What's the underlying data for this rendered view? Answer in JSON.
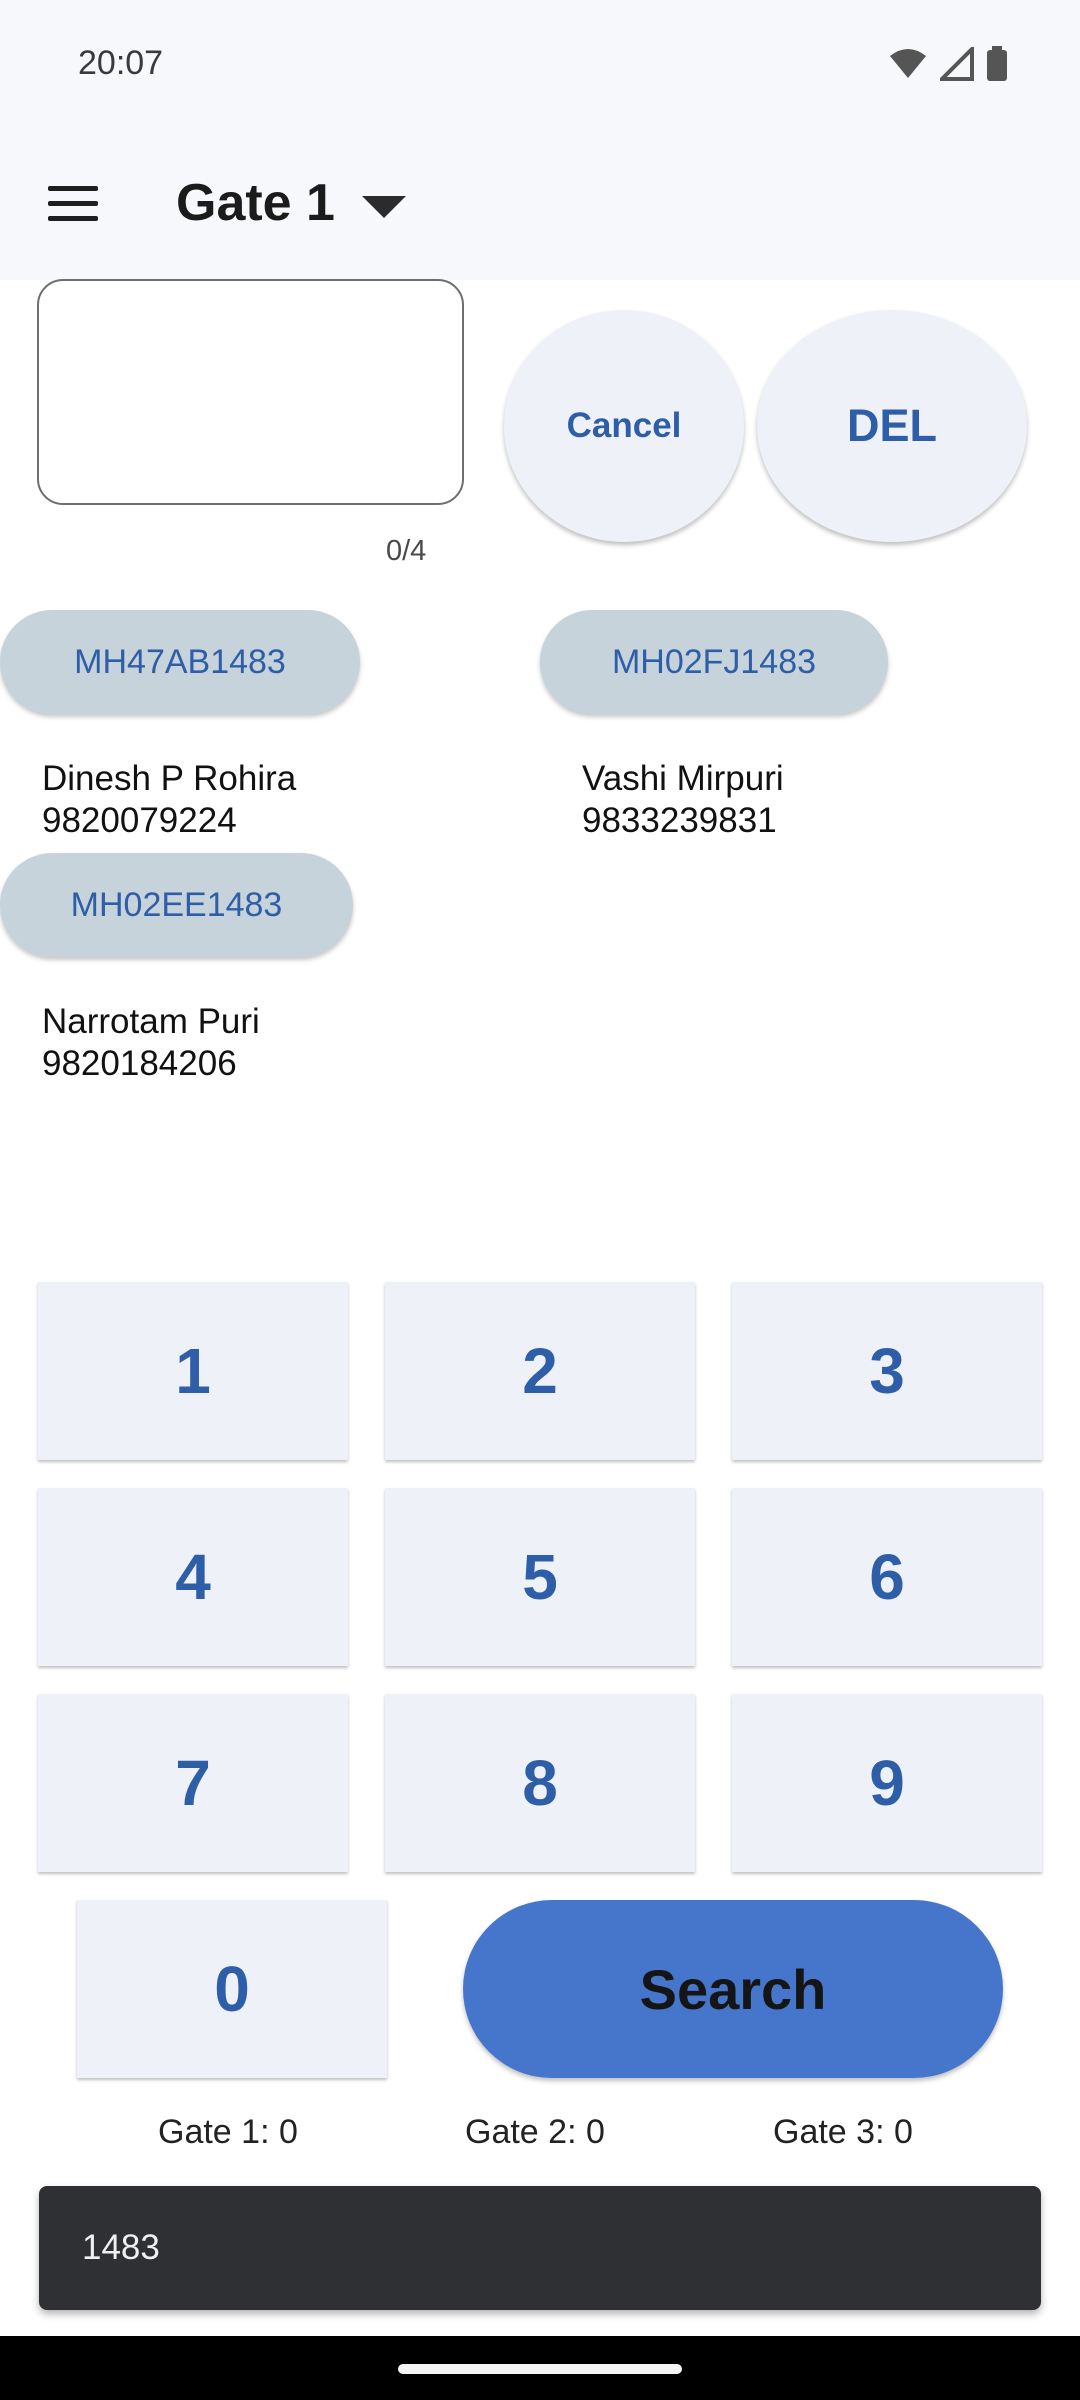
{
  "status_bar": {
    "time": "20:07",
    "icons": [
      "wifi-icon",
      "signal-icon",
      "battery-icon"
    ]
  },
  "app_bar": {
    "title": "Gate 1"
  },
  "input": {
    "value": "",
    "counter": "0/4"
  },
  "buttons": {
    "cancel": "Cancel",
    "del": "DEL",
    "search": "Search"
  },
  "results": [
    {
      "plate": "MH47AB1483",
      "name": "Dinesh P Rohira",
      "phone": "9820079224"
    },
    {
      "plate": "MH02FJ1483",
      "name": "Vashi Mirpuri",
      "phone": "9833239831"
    },
    {
      "plate": "MH02EE1483",
      "name": "Narrotam Puri",
      "phone": "9820184206"
    }
  ],
  "keypad": [
    "1",
    "2",
    "3",
    "4",
    "5",
    "6",
    "7",
    "8",
    "9",
    "0"
  ],
  "gate_counts": [
    "Gate 1: 0",
    "Gate 2: 0",
    "Gate 3: 0"
  ],
  "snackbar": {
    "text": "1483"
  },
  "colors": {
    "accent": "#2f5ea8",
    "search_button": "#4676cc",
    "chip": "#c7d3da",
    "key_bg": "#eef2f8"
  }
}
